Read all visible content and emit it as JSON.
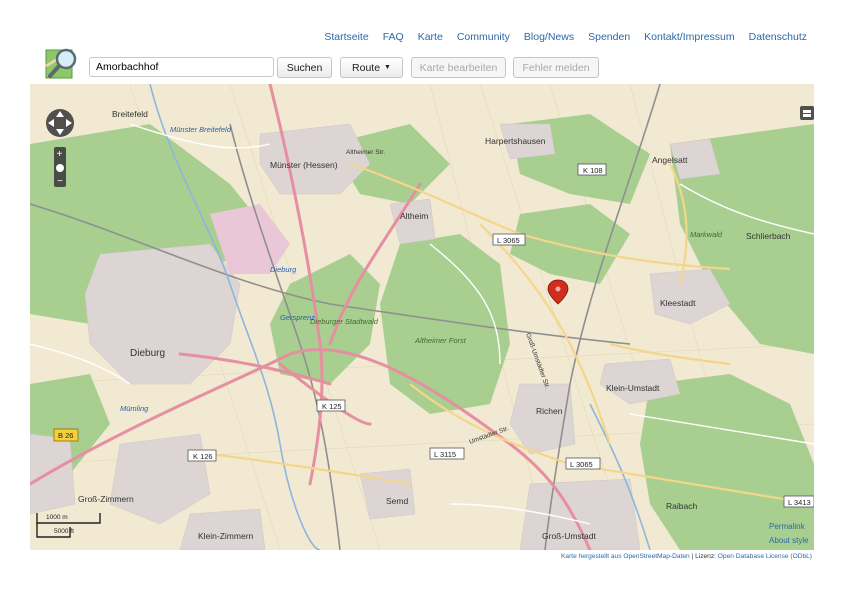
{
  "nav": {
    "items": [
      "Startseite",
      "FAQ",
      "Karte",
      "Community",
      "Blog/News",
      "Spenden",
      "Kontakt/Impressum",
      "Datenschutz"
    ]
  },
  "search": {
    "value": "Amorbachhof",
    "button": "Suchen"
  },
  "toolbar": {
    "route_label": "Route",
    "edit_label": "Karte bearbeiten",
    "report_label": "Fehler melden"
  },
  "map": {
    "places": [
      {
        "name": "Breitefeld"
      },
      {
        "name": "Münster (Hessen)"
      },
      {
        "name": "Altheim"
      },
      {
        "name": "Harpertshausen"
      },
      {
        "name": "Angelsatt"
      },
      {
        "name": "Schlierbach"
      },
      {
        "name": "Kleestadt"
      },
      {
        "name": "Dieburg"
      },
      {
        "name": "Klein-Umstadt"
      },
      {
        "name": "Richen"
      },
      {
        "name": "Groß-Zimmern"
      },
      {
        "name": "Semd"
      },
      {
        "name": "Klein-Zimmern"
      },
      {
        "name": "Groß-Umstadt"
      },
      {
        "name": "Raibach"
      }
    ],
    "water_labels": [
      "Münster Breitefeld",
      "Dieburg",
      "Gersprenz",
      "Mümling"
    ],
    "forest_labels": [
      "Markwald",
      "Altheimer Forst",
      "Dieburger Stadtwald"
    ],
    "roads": [
      "K 108",
      "L 3065",
      "K 125",
      "K 126",
      "L 3115",
      "L 3065",
      "B 26",
      "L 3413"
    ],
    "streets": [
      "Altheimer Str.",
      "Groß-Umstädter Str.",
      "Umstädter Str."
    ],
    "marker_color": "#d22c1f"
  },
  "scale": {
    "metric": "1000 m",
    "imperial": "5000 ft"
  },
  "links": {
    "permalink": "Permalink",
    "about_style": "About style"
  },
  "attribution": {
    "text1": "Karte hergestellt aus OpenStreetMap-Daten",
    "sep": " | Lizenz: ",
    "text2": "Open Database License (ODbL)"
  }
}
